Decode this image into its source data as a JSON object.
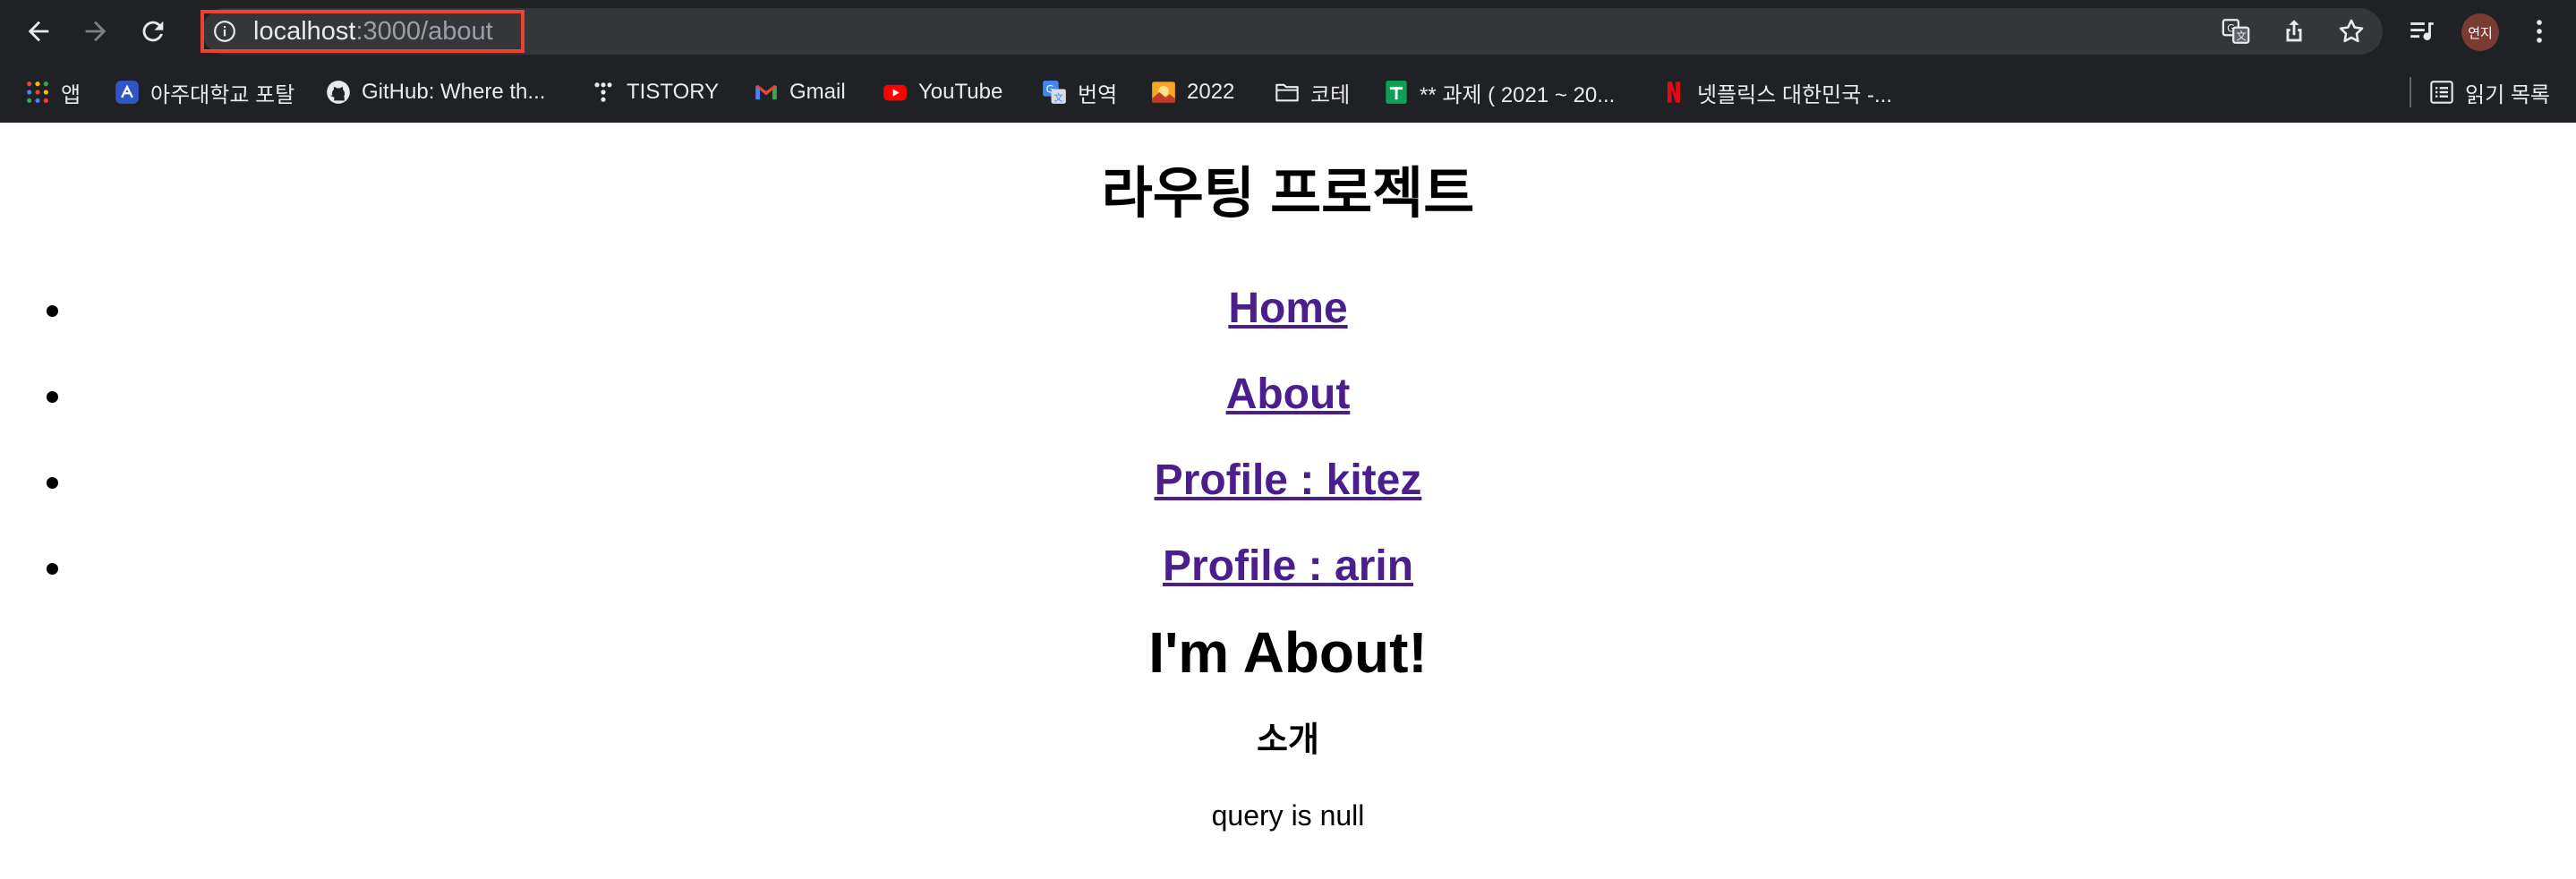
{
  "browser": {
    "url_host": "localhost",
    "url_path": ":3000/about",
    "profile_initials": "연지",
    "bookmarks": [
      {
        "label": "앱",
        "icon": "apps-grid-icon"
      },
      {
        "label": "아주대학교 포탈",
        "icon": "ajou-portal-icon"
      },
      {
        "label": "GitHub: Where th...",
        "icon": "github-icon"
      },
      {
        "label": "TISTORY",
        "icon": "tistory-icon"
      },
      {
        "label": "Gmail",
        "icon": "gmail-icon"
      },
      {
        "label": "YouTube",
        "icon": "youtube-icon"
      },
      {
        "label": "번역",
        "icon": "translate-icon"
      },
      {
        "label": "2022",
        "icon": "photo-icon"
      },
      {
        "label": "코테",
        "icon": "folder-icon"
      },
      {
        "label": "** 과제 ( 2021 ~ 20...",
        "icon": "sheets-icon"
      },
      {
        "label": "넷플릭스 대한민국 -...",
        "icon": "netflix-icon"
      }
    ],
    "reading_list_label": "읽기 목록",
    "colors": {
      "chrome_bg": "#202124",
      "omnibox_bg": "#35363a",
      "highlight": "#e8442f"
    }
  },
  "page": {
    "title": "라우팅 프로젝트",
    "nav_links": [
      {
        "label": "Home"
      },
      {
        "label": "About"
      },
      {
        "label": "Profile : kitez"
      },
      {
        "label": "Profile : arin"
      }
    ],
    "heading": "I'm About!",
    "subheading": "소개",
    "query_text": "query is null",
    "link_color": "#4a1e8c"
  }
}
